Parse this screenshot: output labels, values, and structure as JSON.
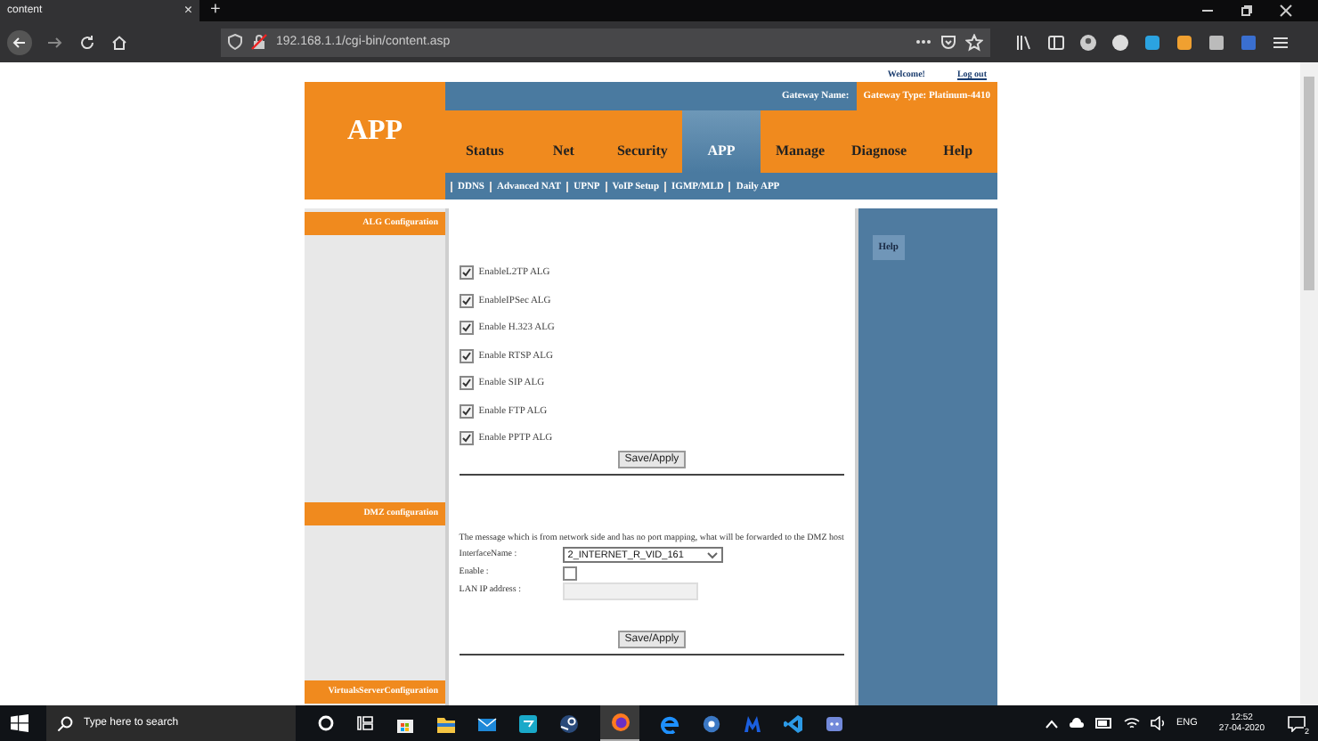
{
  "browser": {
    "tab": {
      "title": "content",
      "close": "×"
    },
    "new_tab": "+",
    "address": "192.168.1.1/cgi-bin/content.asp"
  },
  "header": {
    "welcome": "Welcome!",
    "logout": "Log out",
    "logo": "APP",
    "gateway_name": "Gateway Name:",
    "gateway_type": "Gateway Type: Platinum-4410"
  },
  "nav": [
    {
      "label": "Status",
      "selected": false
    },
    {
      "label": "Net",
      "selected": false
    },
    {
      "label": "Security",
      "selected": false
    },
    {
      "label": "APP",
      "selected": true
    },
    {
      "label": "Manage",
      "selected": false
    },
    {
      "label": "Diagnose",
      "selected": false
    },
    {
      "label": "Help",
      "selected": false
    }
  ],
  "subnav": [
    "DDNS",
    "Advanced NAT",
    "UPNP",
    "VoIP Setup",
    "IGMP/MLD",
    "Daily APP"
  ],
  "sidebar": [
    "ALG Configuration",
    "DMZ configuration",
    "VirtualsServerConfiguration"
  ],
  "alg": {
    "options": [
      {
        "label": "EnableL2TP ALG",
        "checked": true
      },
      {
        "label": "EnableIPSec ALG",
        "checked": true
      },
      {
        "label": "Enable H.323 ALG",
        "checked": true
      },
      {
        "label": "Enable RTSP ALG",
        "checked": true
      },
      {
        "label": "Enable SIP ALG",
        "checked": true
      },
      {
        "label": "Enable FTP ALG",
        "checked": true
      },
      {
        "label": "Enable PPTP ALG",
        "checked": true
      }
    ],
    "button": "Save/Apply"
  },
  "dmz": {
    "message": "The message which is from network side and has no port mapping, what will be forwarded to the DMZ host",
    "interface_label": "InterfaceName :",
    "interface_value": "2_INTERNET_R_VID_161",
    "enable_label": "Enable :",
    "enable_checked": false,
    "lan_ip_label": "LAN IP address :",
    "button": "Save/Apply"
  },
  "help_button": "Help",
  "taskbar": {
    "search_placeholder": "Type here to search",
    "language": "ENG",
    "time": "12:52",
    "date": "27-04-2020",
    "notifications": "2"
  }
}
